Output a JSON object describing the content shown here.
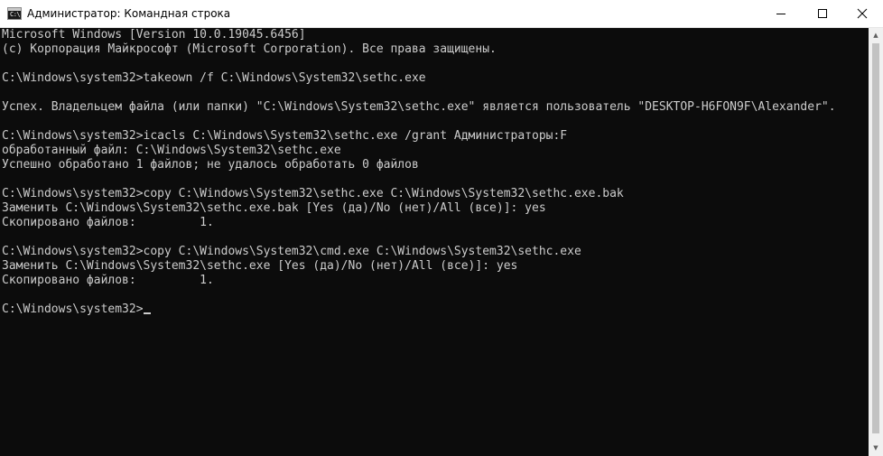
{
  "window": {
    "title": "Администратор: Командная строка",
    "icon": "cmd-icon",
    "icon_text": "C:\\",
    "controls": {
      "minimize": "minimize-icon",
      "maximize": "maximize-icon",
      "close": "close-icon"
    }
  },
  "console": {
    "lines": [
      "Microsoft Windows [Version 10.0.19045.6456]",
      "(c) Корпорация Майкрософт (Microsoft Corporation). Все права защищены.",
      "",
      "C:\\Windows\\system32>takeown /f C:\\Windows\\System32\\sethc.exe",
      "",
      "Успех. Владельцем файла (или папки) \"C:\\Windows\\System32\\sethc.exe\" является пользователь \"DESKTOP-H6FON9F\\Alexander\".",
      "",
      "C:\\Windows\\system32>icacls C:\\Windows\\System32\\sethc.exe /grant Администраторы:F",
      "обработанный файл: C:\\Windows\\System32\\sethc.exe",
      "Успешно обработано 1 файлов; не удалось обработать 0 файлов",
      "",
      "C:\\Windows\\system32>copy C:\\Windows\\System32\\sethc.exe C:\\Windows\\System32\\sethc.exe.bak",
      "Заменить C:\\Windows\\System32\\sethc.exe.bak [Yes (да)/No (нет)/All (все)]: yes",
      "Скопировано файлов:         1.",
      "",
      "C:\\Windows\\system32>copy C:\\Windows\\System32\\cmd.exe C:\\Windows\\System32\\sethc.exe",
      "Заменить C:\\Windows\\System32\\sethc.exe [Yes (да)/No (нет)/All (все)]: yes",
      "Скопировано файлов:         1.",
      ""
    ],
    "prompt": "C:\\Windows\\system32>"
  },
  "colors": {
    "background": "#0c0c0c",
    "text": "#cccccc",
    "titlebar": "#ffffff"
  }
}
